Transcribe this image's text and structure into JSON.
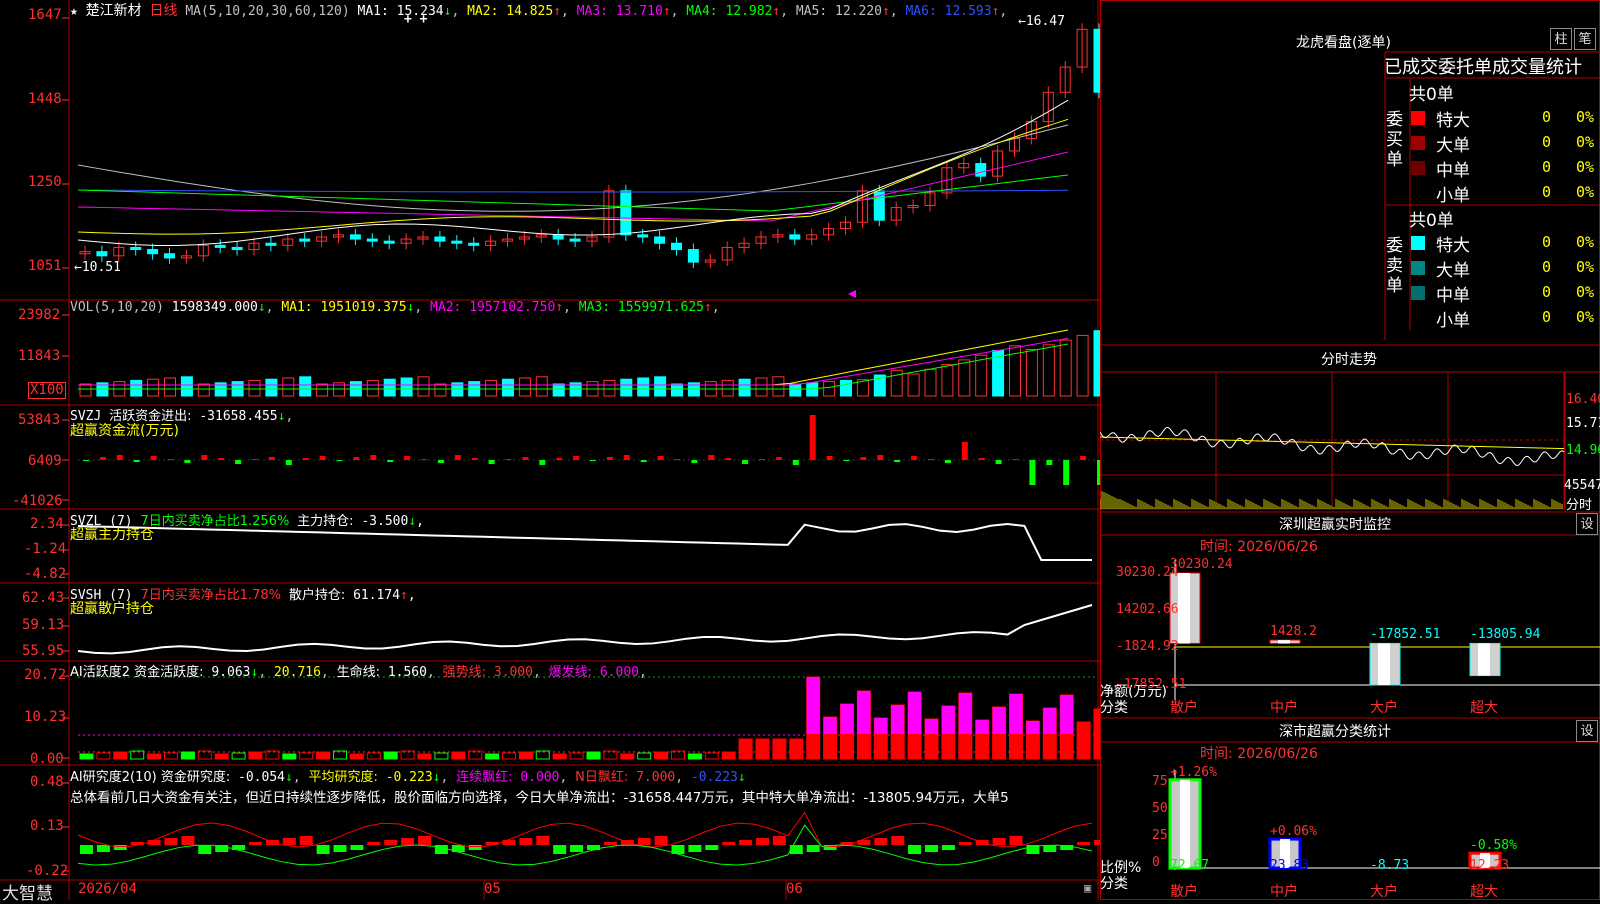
{
  "main": {
    "star": "★",
    "stock_name": "楚江新材",
    "period": "日线",
    "ma_label": "MA(5,10,20,30,60,120)",
    "ma_values": [
      {
        "label": "MA1:",
        "value": "15.234",
        "arrow": "↓",
        "color": "#ffffff"
      },
      {
        "label": "MA2:",
        "value": "14.825",
        "arrow": "↑",
        "color": "#ffff00"
      },
      {
        "label": "MA3:",
        "value": "13.710",
        "arrow": "↑",
        "color": "#ff00ff"
      },
      {
        "label": "MA4:",
        "value": "12.982",
        "arrow": "↑",
        "color": "#00ff00"
      },
      {
        "label": "MA5:",
        "value": "12.220",
        "arrow": "↑",
        "color": "#c0c0c0"
      },
      {
        "label": "MA6:",
        "value": "12.593",
        "arrow": "↑",
        "color": "#3050ff"
      }
    ],
    "y_ticks": [
      "1647",
      "1448",
      "1250",
      "1051"
    ],
    "high_label": "16.47",
    "low_label": "10.51",
    "plus_marks": "+ +",
    "scale_mode": "x100"
  },
  "vol": {
    "label": "VOL(5,10,20)",
    "value": "1598349.000",
    "value_arrow": "↓",
    "ma": [
      {
        "label": "MA1:",
        "value": "1951019.375",
        "arrow": "↓",
        "color": "#ffff00"
      },
      {
        "label": "MA2:",
        "value": "1957102.750",
        "arrow": "↑",
        "color": "#ff00ff"
      },
      {
        "label": "MA3:",
        "value": "1559971.625",
        "arrow": "↑",
        "color": "#00ff00"
      }
    ],
    "y_ticks": [
      "23982",
      "11843"
    ],
    "unit": "X100"
  },
  "svzj": {
    "code": "SVZJ",
    "label": "活跃资金进出:",
    "value": "-31658.455",
    "arrow": "↓",
    "sub": "超赢资金流(万元)",
    "y_ticks": [
      "53843",
      "6409",
      "-41026"
    ]
  },
  "svzl": {
    "code": "SVZL (7)",
    "desc": "7日内买卖净占比1.256%",
    "label": "主力持仓:",
    "value": "-3.500",
    "arrow": "↓",
    "trail": ",",
    "sub": "超赢主力持仓",
    "y_ticks": [
      "2.34",
      "-1.24",
      "-4.82"
    ]
  },
  "svsh": {
    "code": "SVSH (7)",
    "desc": "7日内买卖净占比1.78%",
    "label": "散户持仓:",
    "value": "61.174",
    "arrow": "↑",
    "trail": ",",
    "sub": "超赢散户持仓",
    "y_ticks": [
      "62.43",
      "59.13",
      "55.95"
    ]
  },
  "ai_active": {
    "label": "AI活跃度2 资金活跃度:",
    "value": "9.063",
    "arrow": "↓",
    "v2": "20.716",
    "life_label": "生命线:",
    "life_value": "1.560",
    "strong_label": "强势线:",
    "strong_value": "3.000",
    "burst_label": "爆发线:",
    "burst_value": "6.000",
    "y_ticks": [
      "20.72",
      "10.23",
      "0.00"
    ]
  },
  "ai_research": {
    "label": "AI研究度2(10) 资金研究度:",
    "value": "-0.054",
    "arrow": "↓",
    "avg_label": "平均研究度:",
    "avg_value": "-0.223",
    "streak_label": "连续飘红:",
    "streak_value": "0.000",
    "nday_label": "N日飘红:",
    "nday_value": "7.000",
    "last_value": "-0.223",
    "y_ticks": [
      "0.48",
      "0.13",
      "-0.22"
    ],
    "comment": "总体看前几日大资金有关注，但近日持续性逐步降低，股价面临方向选择，今日大单净流出：-31658.447万元，其中特大单净流出：-13805.94万元，大单5"
  },
  "bottom": {
    "brand": "大智慧",
    "date_start": "2026/04",
    "month_05": "05",
    "month_06": "06"
  },
  "dragon": {
    "title": "龙虎看盘(逐单)",
    "btn_bar": "柱",
    "btn_tick": "笔",
    "header": "已成交委托单成交量统计",
    "buy_label": "委买单",
    "sell_label": "委卖单",
    "buy_total": "共0单",
    "sell_total": "共0单",
    "buy_rows": [
      {
        "name": "特大",
        "count": "0",
        "pct": "0%",
        "color": "#ff0000"
      },
      {
        "name": "大单",
        "count": "0",
        "pct": "0%",
        "color": "#a00000"
      },
      {
        "name": "中单",
        "count": "0",
        "pct": "0%",
        "color": "#700000"
      },
      {
        "name": "小单",
        "count": "0",
        "pct": "0%",
        "color": "#000000"
      }
    ],
    "sell_rows": [
      {
        "name": "特大",
        "count": "0",
        "pct": "0%",
        "color": "#00ffff"
      },
      {
        "name": "大单",
        "count": "0",
        "pct": "0%",
        "color": "#008888"
      },
      {
        "name": "中单",
        "count": "0",
        "pct": "0%",
        "color": "#007070"
      },
      {
        "name": "小单",
        "count": "0",
        "pct": "0%",
        "color": "#000000"
      }
    ]
  },
  "intraday": {
    "title": "分时走势",
    "prices": [
      "16.40",
      "15.71",
      "14.96"
    ],
    "vol": "45547",
    "vol_unit": "分时"
  },
  "monitor": {
    "title": "深圳超赢实时监控",
    "btn": "设",
    "time": "时间: 2026/06/26",
    "y_ticks": [
      "30230.24",
      "14202.66",
      "-1824.92",
      "-17852.51"
    ],
    "y_label": "净额(万元)",
    "x_label": "分类",
    "bar_values": [
      "30230.24",
      "1428.2",
      "-17852.51",
      "-13805.94"
    ],
    "categories": [
      "散户",
      "中户",
      "大户",
      "超大"
    ],
    "chart_data": {
      "type": "bar",
      "categories": [
        "散户",
        "中户",
        "大户",
        "超大"
      ],
      "values": [
        30230.24,
        1428.2,
        -17852.51,
        -13805.94
      ],
      "title": "深圳超赢实时监控",
      "ylabel": "净额(万元)",
      "xlabel": "分类",
      "ylim": [
        -17852.51,
        30230.24
      ]
    }
  },
  "classify": {
    "title": "深市超赢分类统计",
    "btn": "设",
    "time": "时间: 2026/06/26",
    "y_ticks": [
      "75",
      "50",
      "25",
      "0"
    ],
    "y_label": "比例%",
    "x_label": "分类",
    "top_labels": [
      "+1.26%",
      "+0.06%",
      "",
      "-0.58%"
    ],
    "bottom_values": [
      "72.67",
      "23.83",
      "-8.73",
      "12.23"
    ],
    "categories": [
      "散户",
      "中户",
      "大户",
      "超大"
    ],
    "chart_data": {
      "type": "bar",
      "categories": [
        "散户",
        "中户",
        "大户",
        "超大"
      ],
      "values": [
        72.67,
        23.83,
        -8.73,
        12.23
      ],
      "changes": [
        "+1.26%",
        "+0.06%",
        "",
        "-0.58%"
      ],
      "title": "深市超赢分类统计",
      "ylabel": "比例%",
      "xlabel": "分类",
      "ylim": [
        0,
        75
      ]
    }
  }
}
